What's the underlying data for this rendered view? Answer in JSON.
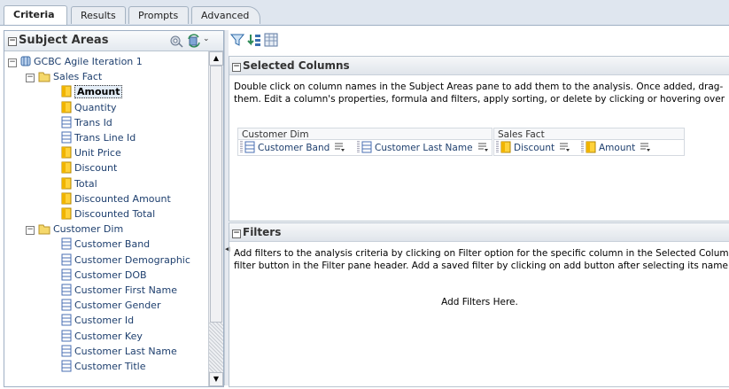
{
  "tabs": [
    "Criteria",
    "Results",
    "Prompts",
    "Advanced"
  ],
  "subject_areas": {
    "title": "Subject Areas",
    "tree": [
      {
        "label": "GCBC Agile Iteration 1",
        "kind": "subject",
        "expander": "−"
      },
      {
        "label": "Sales Fact",
        "kind": "folder",
        "expander": "−"
      },
      {
        "label": "Amount",
        "kind": "measure",
        "selected": true
      },
      {
        "label": "Quantity",
        "kind": "measure"
      },
      {
        "label": "Trans Id",
        "kind": "attribute"
      },
      {
        "label": "Trans Line Id",
        "kind": "attribute"
      },
      {
        "label": "Unit Price",
        "kind": "measure"
      },
      {
        "label": "Discount",
        "kind": "measure"
      },
      {
        "label": "Total",
        "kind": "measure"
      },
      {
        "label": "Discounted Amount",
        "kind": "measure"
      },
      {
        "label": "Discounted Total",
        "kind": "measure"
      },
      {
        "label": "Customer Dim",
        "kind": "folder",
        "expander": "−"
      },
      {
        "label": "Customer Band",
        "kind": "attribute"
      },
      {
        "label": "Customer Demographic",
        "kind": "attribute"
      },
      {
        "label": "Customer DOB",
        "kind": "attribute"
      },
      {
        "label": "Customer First Name",
        "kind": "attribute"
      },
      {
        "label": "Customer Gender",
        "kind": "attribute"
      },
      {
        "label": "Customer Id",
        "kind": "attribute"
      },
      {
        "label": "Customer Key",
        "kind": "attribute"
      },
      {
        "label": "Customer Last Name",
        "kind": "attribute"
      },
      {
        "label": "Customer Title",
        "kind": "attribute"
      }
    ]
  },
  "selected_columns": {
    "title": "Selected Columns",
    "description": [
      "Double click on column names in the Subject Areas pane to add them to the analysis. Once added, drag-",
      "them. Edit a column's properties, formula and filters, apply sorting, or delete by clicking or hovering over"
    ],
    "groups": [
      {
        "name": "Customer Dim",
        "columns": [
          {
            "label": "Customer Band",
            "kind": "attribute"
          },
          {
            "label": "Customer Last Name",
            "kind": "attribute"
          }
        ]
      },
      {
        "name": "Sales Fact",
        "columns": [
          {
            "label": "Discount",
            "kind": "measure"
          },
          {
            "label": "Amount",
            "kind": "measure"
          }
        ]
      }
    ]
  },
  "filters": {
    "title": "Filters",
    "description": [
      "Add filters to the analysis criteria by clicking on Filter option for the specific column in the Selected Columr",
      "filter button in the Filter pane header. Add a saved filter by clicking on add button after selecting its name"
    ],
    "empty_text": "Add Filters Here."
  },
  "icons": {
    "collapse": "minus-box-icon",
    "subject": "cube-icon",
    "folder": "folder-icon",
    "measure": "measure-column-icon",
    "attribute": "attribute-column-icon",
    "column_menu": "column-menu-icon"
  },
  "colors": {
    "tab_bar": "#dfe6ef",
    "tree_text": "#1e3f6e",
    "measure": "#f0b400",
    "folder": "#e8c44a",
    "attribute": "#4a6fb3"
  }
}
